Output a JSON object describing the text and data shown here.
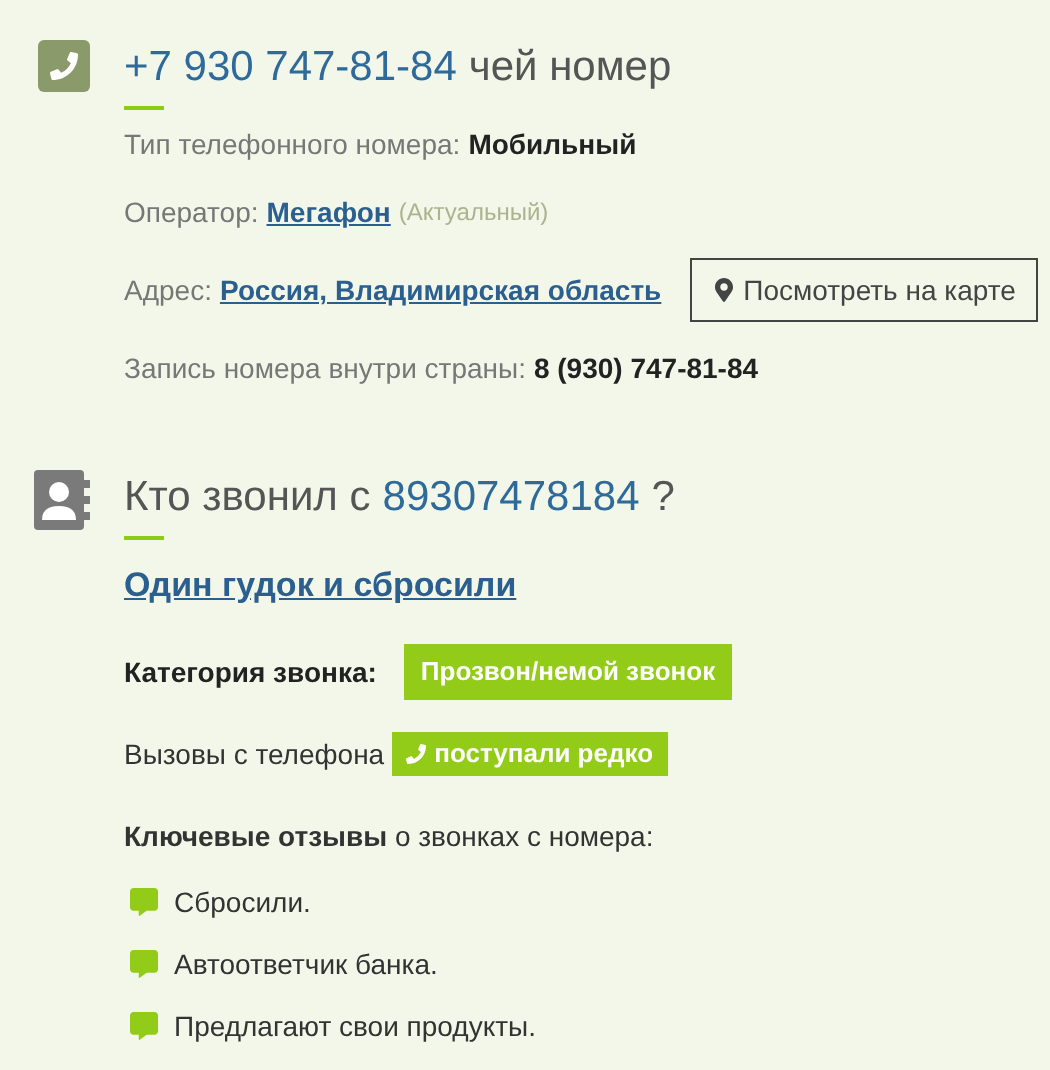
{
  "number_section": {
    "number": "+7 930 747-81-84",
    "title_suffix": "чей номер",
    "type": {
      "label": "Тип телефонного номера:",
      "value": "Мобильный"
    },
    "operator": {
      "label": "Оператор:",
      "value": "Мегафон",
      "note": "(Актуальный)"
    },
    "address": {
      "label": "Адрес:",
      "value": "Россия, Владимирская область",
      "map_button": "Посмотреть на карте"
    },
    "domestic": {
      "label": "Запись номера внутри страны:",
      "value": "8 (930) 747-81-84"
    }
  },
  "caller_section": {
    "title_prefix": "Кто звонил с",
    "number": "89307478184",
    "title_suffix": "?",
    "verdict_link": "Один гудок и сбросили",
    "category": {
      "label": "Категория звонка:",
      "value": "Прозвон/немой звонок"
    },
    "frequency": {
      "label": "Вызовы с телефона",
      "value": "поступали редко"
    },
    "reviews_heading": "**Ключевые отзывы** о звонках с номера:",
    "reviews": [
      "Сбросили.",
      "Автоответчик банка.",
      "Предлагают свои продукты."
    ]
  }
}
